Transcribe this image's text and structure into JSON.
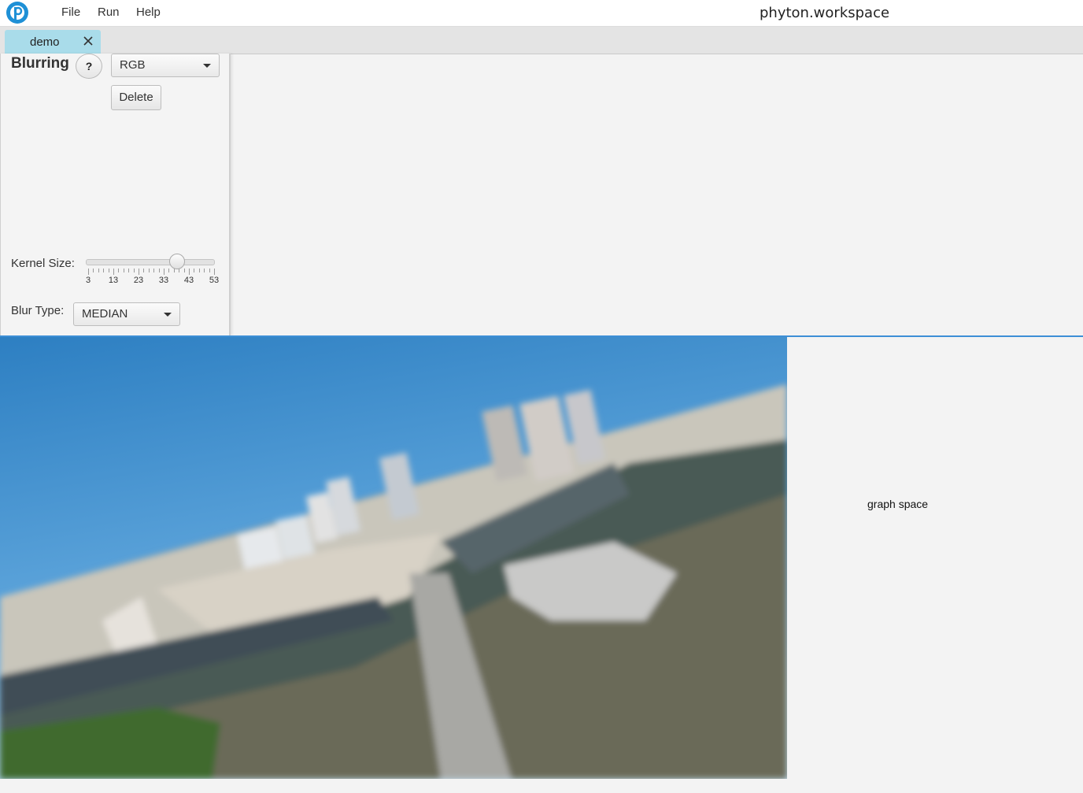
{
  "menubar": {
    "items": [
      "File",
      "Run",
      "Help"
    ],
    "window_title": "phyton.workspace"
  },
  "tabs": [
    {
      "label": "demo",
      "active": true
    }
  ],
  "node": {
    "title": "Blurring",
    "help_label": "?",
    "color_mode": "RGB",
    "delete_label": "Delete",
    "kernel_size_label": "Kernel Size:",
    "kernel_ticks": [
      "3",
      "13",
      "23",
      "33",
      "43",
      "53"
    ],
    "kernel_value": 38,
    "kernel_min": 3,
    "kernel_max": 53,
    "blur_type_label": "Blur Type:",
    "blur_type": "MEDIAN"
  },
  "graph": {
    "placeholder": "graph space"
  },
  "colors": {
    "tab_active": "#a9dcea",
    "accent_line": "#3d8fd6",
    "logo": "#1e90d6"
  }
}
